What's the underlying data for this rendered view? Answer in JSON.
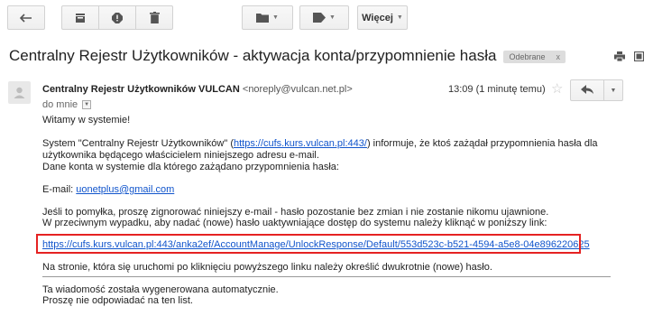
{
  "toolbar": {
    "more_label": "Więcej"
  },
  "email": {
    "subject": "Centralny Rejestr Użytkowników - aktywacja konta/przypomnienie hasła",
    "label": "Odebrane",
    "label_remove": "x",
    "sender_name": "Centralny Rejestr Użytkowników VULCAN",
    "sender_email": "<noreply@vulcan.net.pl>",
    "to": "do mnie",
    "time": "13:09 (1 minutę temu)",
    "body": {
      "greeting": "Witamy w systemie!",
      "p1_pre": "System \"Centralny Rejestr Użytkowników\" (",
      "p1_link": "https://cufs.kurs.vulcan.pl:443/",
      "p1_post": ") informuje, że ktoś zażądał przypomnienia hasła dla",
      "p1_line2": "użytkownika będącego właścicielem niniejszego adresu e-mail.",
      "p1_line3": "Dane konta w systemie dla którego zażądano przypomnienia hasła:",
      "email_label": "E-mail: ",
      "email_value": "uonetplus@gmail.com",
      "p2_line1": "Jeśli to pomyłka, proszę zignorować niniejszy e-mail - hasło pozostanie bez zmian i nie zostanie nikomu ujawnione.",
      "p2_line2": "W przeciwnym wypadku, aby nadać (nowe) hasło uaktywniające dostęp do systemu należy kliknąć w poniższy link:",
      "reset_link": "https://cufs.kurs.vulcan.pl:443/anka2ef/AccountManage/UnlockResponse/Default/553d523c-b521-4594-a5e8-04e896220625",
      "p3": "Na stronie, która się uruchomi po kliknięciu powyższego linku należy określić dwukrotnie (nowe) hasło.",
      "footer1": "Ta wiadomość została wygenerowana automatycznie.",
      "footer2": "Proszę nie odpowiadać na ten list."
    }
  },
  "colors": {
    "link": "#1155cc",
    "highlight_box": "#e52222",
    "label_chip": "#dddddd"
  }
}
